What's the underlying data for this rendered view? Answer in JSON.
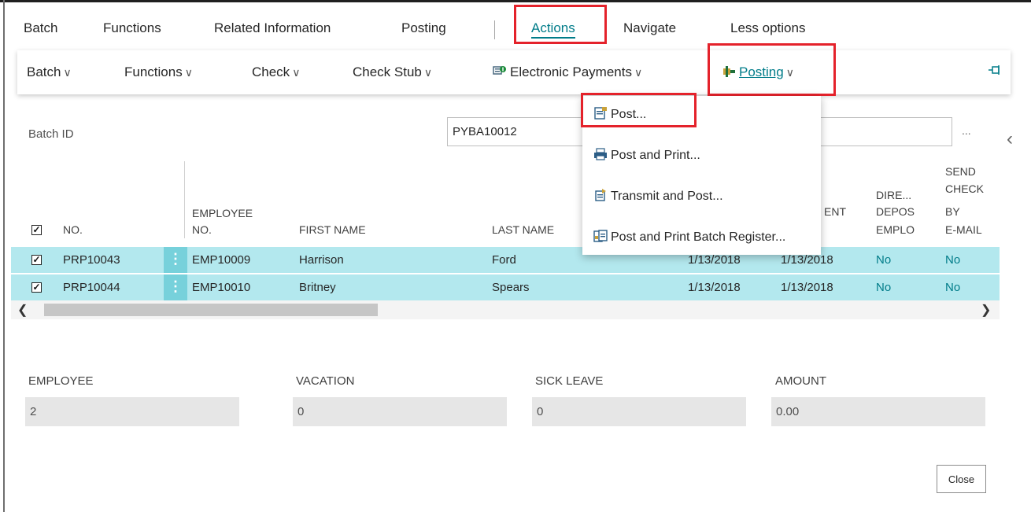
{
  "action_bar": {
    "items": [
      "Batch",
      "Functions",
      "Related Information",
      "Posting",
      "Actions",
      "Navigate",
      "Less options"
    ]
  },
  "sub_toolbar": {
    "items": [
      "Batch",
      "Functions",
      "Check",
      "Check Stub",
      "Electronic Payments",
      "Posting"
    ],
    "chevron": "∨",
    "pin_icon": "pin-icon"
  },
  "batch": {
    "label": "Batch ID",
    "value": "PYBA10012",
    "lookup": "..."
  },
  "grid": {
    "columns": {
      "no": "NO.",
      "emp_no_1": "EMPLOYEE",
      "emp_no_2": "NO.",
      "first_name": "FIRST NAME",
      "last_name": "LAST NAME",
      "ent": "ENT",
      "dire_1": "DIRE...",
      "dire_2": "DEPOS",
      "dire_3": "EMPLO",
      "send_1": "SEND",
      "send_2": "CHECK",
      "send_3": "BY",
      "send_4": "E-MAIL"
    },
    "rows": [
      {
        "no": "PRP10043",
        "emp": "EMP10009",
        "first": "Harrison",
        "last": "Ford",
        "d1": "1/13/2018",
        "d2": "1/13/2018",
        "dire": "No",
        "send": "No"
      },
      {
        "no": "PRP10044",
        "emp": "EMP10010",
        "first": "Britney",
        "last": "Spears",
        "d1": "1/13/2018",
        "d2": "1/13/2018",
        "dire": "No",
        "send": "No"
      }
    ]
  },
  "totals": {
    "employee_label": "EMPLOYEE",
    "employee_value": "2",
    "vacation_label": "VACATION",
    "vacation_value": "0",
    "sick_label": "SICK LEAVE",
    "sick_value": "0",
    "amount_label": "AMOUNT",
    "amount_value": "0.00"
  },
  "posting_menu": {
    "items": [
      "Post...",
      "Post and Print...",
      "Transmit and Post...",
      "Post and Print Batch Register..."
    ]
  },
  "buttons": {
    "close": "Close"
  },
  "colors": {
    "accent": "#007c89",
    "highlight": "#e4222b",
    "row_bg": "#b3e8ee"
  }
}
